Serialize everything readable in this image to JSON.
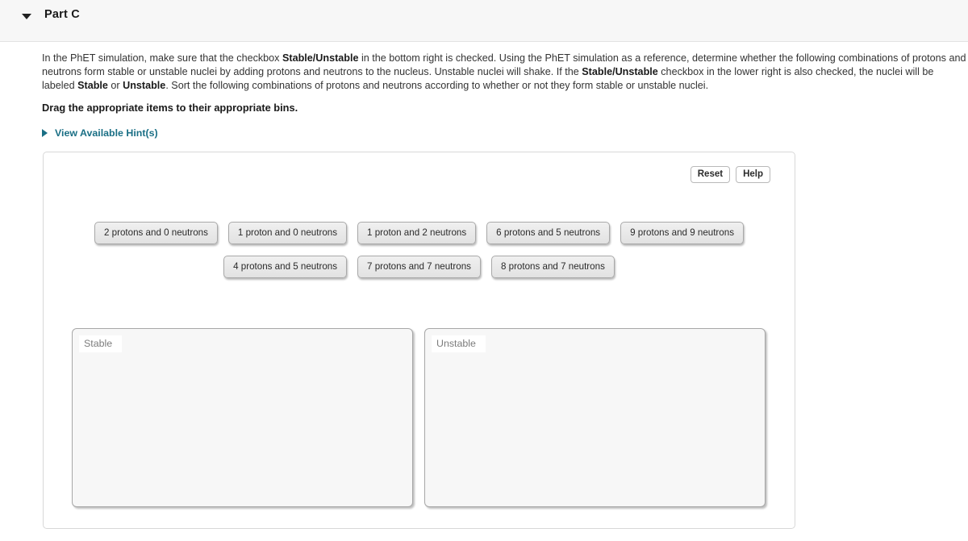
{
  "header": {
    "caret_icon": "caret-down-icon",
    "title": "Part C"
  },
  "prompt": {
    "seg1": "In the PhET simulation, make sure that the checkbox ",
    "bold1": "Stable/Unstable",
    "seg2": " in the bottom right is checked. Using the PhET simulation as a reference, determine whether the following combinations of protons and neutrons form stable or unstable nuclei by adding protons and neutrons to the nucleus. Unstable nuclei will shake. If the ",
    "bold2": "Stable/Unstable",
    "seg3": " checkbox in the lower right is also checked, the nuclei will be labeled ",
    "bold3": "Stable",
    "seg4": " or ",
    "bold4": "Unstable",
    "seg5": ". Sort the following combinations of protons and neutrons according to whether or not they form stable or unstable nuclei."
  },
  "drag_instruction": "Drag the appropriate items to their appropriate bins.",
  "hint": {
    "caret_icon": "caret-right-icon",
    "label": "View Available Hint(s)",
    "color": "#1a6f85"
  },
  "panel": {
    "tools": {
      "reset_label": "Reset",
      "help_label": "Help"
    },
    "tile_rows": [
      [
        "2 protons and 0 neutrons",
        "1 proton and 0 neutrons",
        "1 proton and 2 neutrons",
        "6 protons and 5 neutrons",
        "9 protons and 9 neutrons"
      ],
      [
        "4 protons and 5 neutrons",
        "7 protons and 7 neutrons",
        "8 protons and 7 neutrons"
      ]
    ],
    "bins": [
      {
        "label": "Stable",
        "items": []
      },
      {
        "label": "Unstable",
        "items": []
      }
    ]
  }
}
